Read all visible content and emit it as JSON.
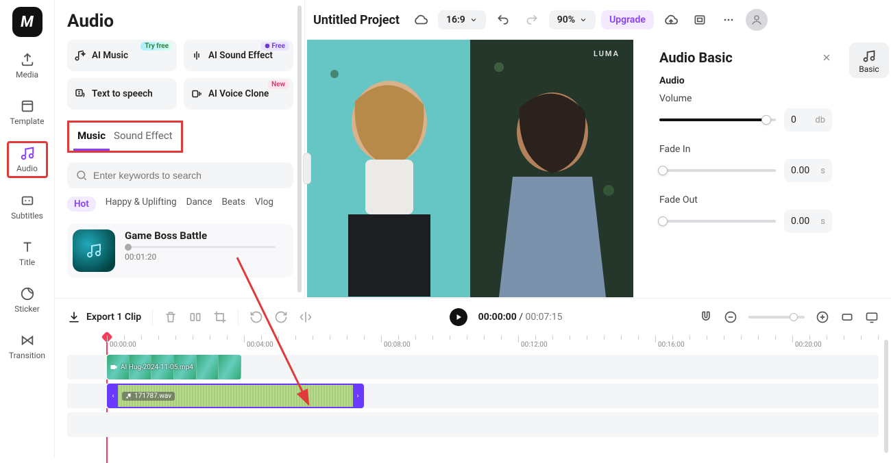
{
  "nav": {
    "media": "Media",
    "template": "Template",
    "audio": "Audio",
    "subtitles": "Subtitles",
    "title": "Title",
    "sticker": "Sticker",
    "transition": "Transition"
  },
  "panel": {
    "title": "Audio",
    "ai_music": "AI Music",
    "ai_music_badge": "Try free",
    "ai_se": "AI Sound Effect",
    "ai_se_badge": "Free",
    "tts": "Text to speech",
    "voice_clone": "AI Voice Clone",
    "voice_clone_badge": "New",
    "tab_music": "Music",
    "tab_se": "Sound Effect",
    "search_placeholder": "Enter keywords to search",
    "tags": {
      "hot": "Hot",
      "happy": "Happy & Uplifting",
      "dance": "Dance",
      "beats": "Beats",
      "vlog": "Vlog"
    },
    "track": {
      "title": "Game Boss Battle",
      "duration": "00:01:20"
    }
  },
  "header": {
    "project": "Untitled Project",
    "aspect": "16:9",
    "zoom": "90%",
    "upgrade": "Upgrade"
  },
  "preview": {
    "watermark": "LUMA"
  },
  "right": {
    "title": "Audio Basic",
    "audio_h": "Audio",
    "vol_label": "Volume",
    "vol_val": "0",
    "vol_unit": "db",
    "fadein_label": "Fade In",
    "fadein_val": "0.00",
    "s_unit": "s",
    "fadeout_label": "Fade Out",
    "fadeout_val": "0.00",
    "basic_tab": "Basic"
  },
  "bottom": {
    "export": "Export 1 Clip",
    "cur": "00:00:00",
    "sep": " / ",
    "dur": "00:07:15",
    "ruler": [
      "00:00:00",
      "00:04:00",
      "00:08:00",
      "00:12:00",
      "00:16:00",
      "00:20:00"
    ],
    "video_clip": "AI Hug-2024-11-05.mp4",
    "audio_clip": "171787.wav"
  }
}
